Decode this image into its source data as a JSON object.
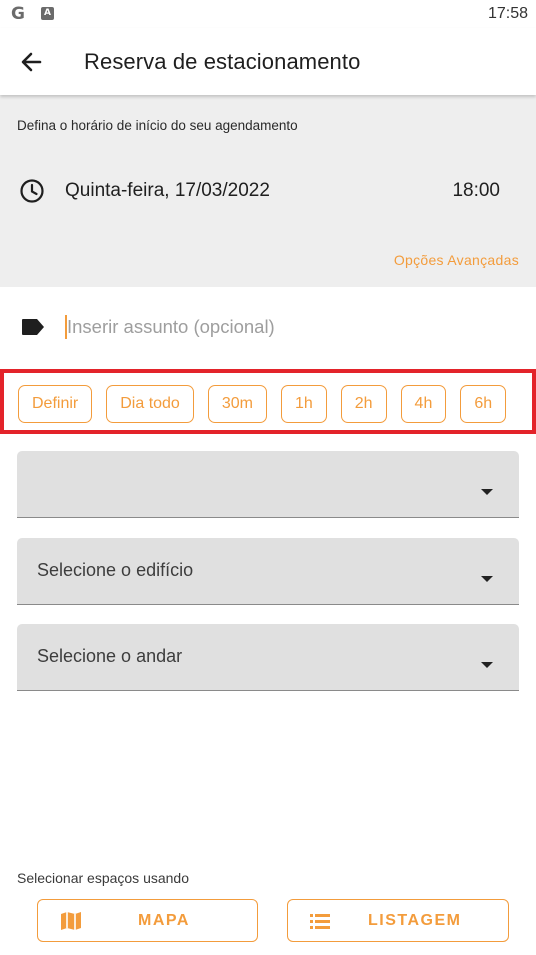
{
  "status_bar": {
    "time": "17:58",
    "google_icon_glyph": "G",
    "accessibility_icon_glyph": "A"
  },
  "app_bar": {
    "title": "Reserva de estacionamento",
    "back_icon": "arrow-left-icon"
  },
  "schedule": {
    "hint": "Defina o horário de início do seu agendamento",
    "date": "Quinta-feira, 17/03/2022",
    "time": "18:00",
    "advanced_label": "Opções Avançadas",
    "clock_icon": "clock-icon"
  },
  "subject": {
    "placeholder": "Inserir assunto (opcional)",
    "value": "",
    "tag_icon": "tag-icon"
  },
  "duration_chips": [
    "Definir",
    "Dia todo",
    "30m",
    "1h",
    "2h",
    "4h",
    "6h"
  ],
  "dropdowns": [
    {
      "label": ""
    },
    {
      "label": "Selecione o edifício"
    },
    {
      "label": "Selecione o andar"
    }
  ],
  "bottom": {
    "hint": "Selecionar espaços usando",
    "map_label": "MAPA",
    "list_label": "LISTAGEM"
  },
  "colors": {
    "accent": "#f39c3c",
    "highlight_border": "#e3232a",
    "gray_section": "#eeeeee",
    "dropdown_fill": "#e0e0e0"
  }
}
